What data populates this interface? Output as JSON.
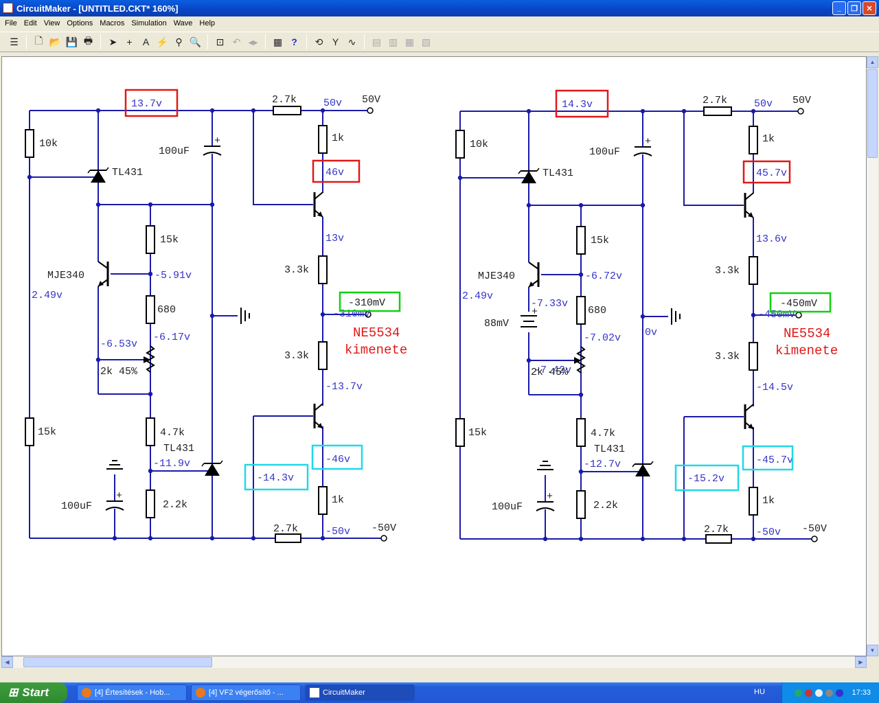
{
  "window": {
    "title": "CircuitMaker - [UNTITLED.CKT* 160%]"
  },
  "menu": [
    "File",
    "Edit",
    "View",
    "Options",
    "Macros",
    "Simulation",
    "Wave",
    "Help"
  ],
  "toolbar_icons": [
    "parts-icon",
    "new-icon",
    "open-icon",
    "save-icon",
    "print-icon",
    "arrow-icon",
    "wire-icon",
    "text-icon",
    "probe-icon",
    "wand-icon",
    "zoom-icon",
    "fit-icon",
    "rotate-icon",
    "mirror-icon",
    "netlist-icon",
    "help-icon",
    "reset-icon",
    "tools-icon",
    "run-icon",
    "pcb1-icon",
    "pcb2-icon",
    "pcb3-icon",
    "pcb4-icon"
  ],
  "colors": {
    "wire": "#1a1aa8",
    "label": "#3333c8",
    "red": "#e01818",
    "green": "#10d010",
    "cyan": "#20d8e8"
  },
  "circuits": [
    {
      "v_ref": "13.7v",
      "r_top": "2.7k",
      "v50": "50v",
      "t50": "50V",
      "r10k": "10k",
      "tl1": "TL431",
      "c1": "100uF",
      "cplus": "+",
      "r1k_top": "1k",
      "v_coll": "46v",
      "r15k": "15k",
      "q1": "MJE340",
      "v_base": "-5.91v",
      "v249": "2.49v",
      "r680": "680",
      "v_680": "-6.17v",
      "v_wiper": "-6.53v",
      "pot": "2k 45%",
      "v_em": "13v",
      "r33a": "3.3k",
      "v_out_box": "-310mV",
      "v_out": "-310mV",
      "ne1": "NE5534",
      "ne2": "kimenete",
      "r33b": "3.3k",
      "v_em2": "-13.7v",
      "r15k_b": "15k",
      "r47": "4.7k",
      "tl2": "TL431",
      "v_tl2": "-11.9v",
      "v_coll2": "-46v",
      "v_base2": "-14.3v",
      "r1k_bot": "1k",
      "c2": "100uF",
      "c2plus": "+",
      "r22": "2.2k",
      "r_bot": "2.7k",
      "vm50": "-50v",
      "tm50": "-50V"
    },
    {
      "v_ref": "14.3v",
      "r_top": "2.7k",
      "v50": "50v",
      "t50": "50V",
      "r10k": "10k",
      "tl1": "TL431",
      "c1": "100uF",
      "cplus": "+",
      "r1k_top": "1k",
      "v_coll": "45.7v",
      "r15k": "15k",
      "q1": "MJE340",
      "v_base": "-6.72v",
      "v249": "2.49v",
      "v_q1e": "-7.33v",
      "bat": "88mV",
      "batplus": "+",
      "r680": "680",
      "v_680": "-7.02v",
      "v_wiper": "-7.42v",
      "pot": "2k 45%",
      "v_em": "13.6v",
      "r33a": "3.3k",
      "v_out_box": "-450mV",
      "v_out": "-450mV",
      "ne1": "NE5534",
      "ne2": "kimenete",
      "r33b": "3.3k",
      "v_em2": "-14.5v",
      "v_gnd": "0v",
      "r15k_b": "15k",
      "r47": "4.7k",
      "tl2": "TL431",
      "v_tl2": "-12.7v",
      "v_coll2": "-45.7v",
      "v_base2": "-15.2v",
      "r1k_bot": "1k",
      "c2": "100uF",
      "c2plus": "+",
      "r22": "2.2k",
      "r_bot": "2.7k",
      "vm50": "-50v",
      "tm50": "-50V"
    }
  ],
  "taskbar": {
    "start": "Start",
    "tasks": [
      "[4] Értesítések - Hob...",
      "[4] VF2 végerősítő - ...",
      "CircuitMaker"
    ],
    "lang": "HU",
    "clock": "17:33"
  }
}
